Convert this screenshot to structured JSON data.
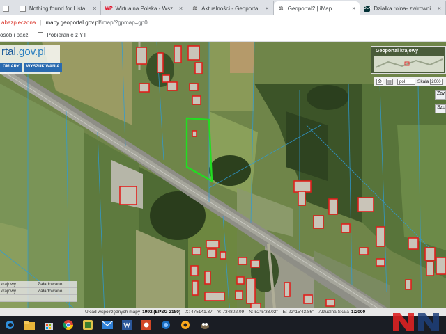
{
  "browser": {
    "tabs": [
      {
        "title": "",
        "icon": "page-icon"
      },
      {
        "title": "Nothing found for Lista",
        "icon": "page-icon"
      },
      {
        "title": "Wirtualna Polska - Wsz",
        "icon": "wp-logo-icon"
      },
      {
        "title": "Aktualności - Geoporta",
        "icon": "geoportal-icon"
      },
      {
        "title": "Geoportal2 | iMap",
        "icon": "geoportal-icon",
        "active": true
      },
      {
        "title": "Działka rolna- zwirowni",
        "icon": "olx-icon"
      }
    ],
    "fav_text": {
      "wp": "WP",
      "olx": "OLX",
      "geo": "⚖"
    },
    "security_label": "abezpieczona",
    "url_host": "mapy.geoportal.gov.pl",
    "url_path": "/imap/?gpmap=gp0",
    "bookmarks": [
      {
        "label": "osób i pacz",
        "icon": "bookmark-page-icon"
      },
      {
        "label": "Pobieranie z YT",
        "icon": "bookmark-page-icon"
      }
    ]
  },
  "map": {
    "logo_main": "rtal",
    "logo_suffix": ".gov.pl",
    "menu": [
      "OMIARY",
      "WYSZUKIWANIA"
    ],
    "overview_title": "Geoportal krajowy",
    "toolbar": {
      "lang": "pol",
      "scale_label": "Skala",
      "scale_value": "2000"
    },
    "side_buttons": [
      "Zaw",
      "Szu"
    ],
    "layers": [
      {
        "name": "krajowy",
        "status": "Załadowano"
      },
      {
        "name": "krajowy",
        "status": "Załadowano"
      },
      {
        "name": "",
        "status": ""
      }
    ],
    "status": {
      "crs_label": "Układ współrzędnych mapy",
      "crs_value": "1992 (EPSG 2180)",
      "x": "X: 475141.37",
      "y": "Y: 734802.09",
      "n": "N: 52°5'33.02\"",
      "e": "E: 22°15'43.86\"",
      "scale_label": "Aktualna Skala",
      "scale_value": "1:2000"
    },
    "colors": {
      "parcel_highlight": "#22dd22",
      "building_outline": "#e0201c"
    }
  }
}
